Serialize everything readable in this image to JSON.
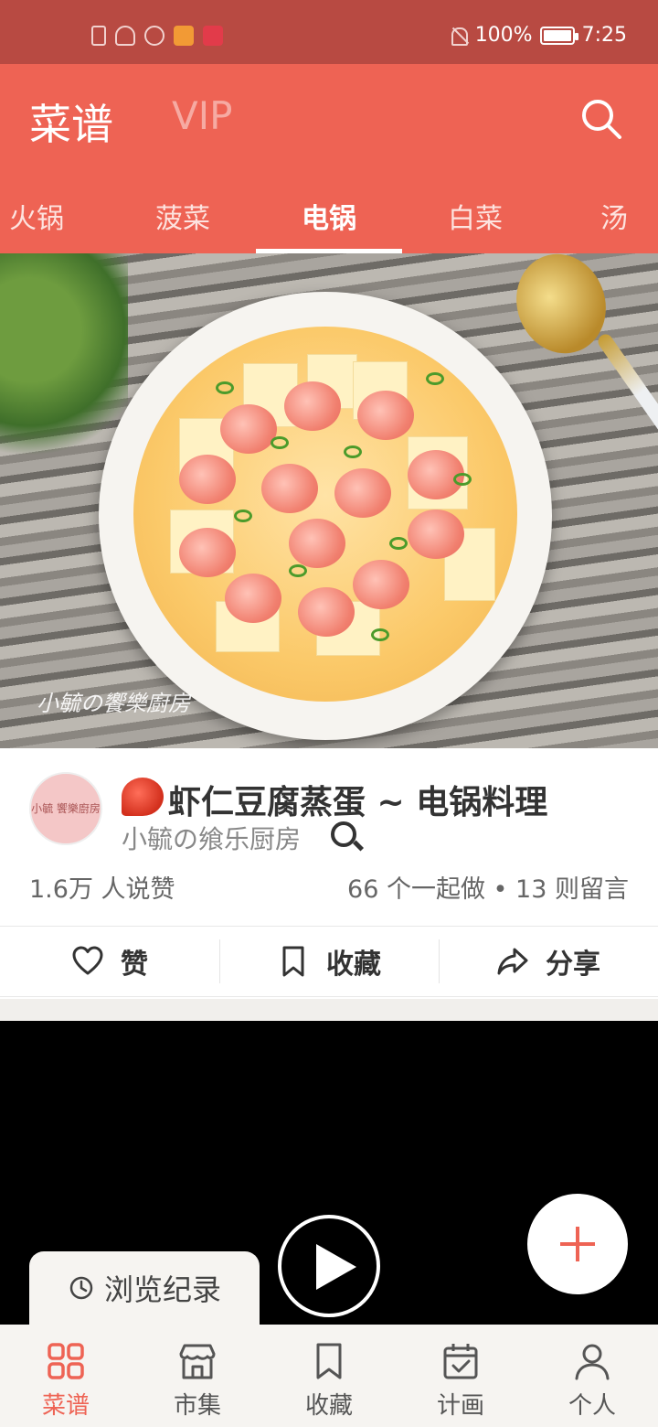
{
  "status_bar": {
    "battery": "100%",
    "time": "7:25"
  },
  "header": {
    "title": "菜谱",
    "vip": "VIP"
  },
  "tabs": [
    {
      "label": "火锅"
    },
    {
      "label": "菠菜"
    },
    {
      "label": "电锅",
      "active": true
    },
    {
      "label": "白菜"
    },
    {
      "label": "汤"
    }
  ],
  "hero": {
    "watermark": "小毓の饗樂廚房"
  },
  "recipe": {
    "avatar_text": "小毓 饗樂廚房",
    "title": "虾仁豆腐蒸蛋 ~ 电锅料理",
    "author": "小毓の飨乐厨房",
    "likes": "1.6万 人说赞",
    "stats": "66 个一起做 • 13 则留言"
  },
  "actions": {
    "like": "赞",
    "collect": "收藏",
    "share": "分享"
  },
  "history": {
    "label": "浏览纪录"
  },
  "bottom_nav": [
    {
      "label": "菜谱",
      "icon": "grid-icon",
      "active": true
    },
    {
      "label": "市集",
      "icon": "store-icon"
    },
    {
      "label": "收藏",
      "icon": "bookmark-icon"
    },
    {
      "label": "计画",
      "icon": "calendar-check-icon"
    },
    {
      "label": "个人",
      "icon": "person-icon"
    }
  ],
  "colors": {
    "brand": "#ee6354",
    "status_bar": "#b84a42"
  }
}
